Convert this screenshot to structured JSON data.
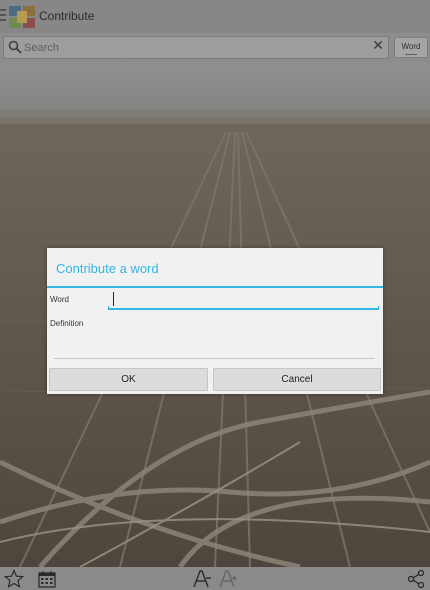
{
  "actionbar": {
    "title": "Contribute"
  },
  "search": {
    "placeholder": "Search",
    "mode_button": "Word"
  },
  "dialog": {
    "title": "Contribute a word",
    "word_label": "Word",
    "word_value": "",
    "definition_label": "Definition",
    "definition_value": "",
    "ok_label": "OK",
    "cancel_label": "Cancel"
  },
  "bottombar": {
    "icons": [
      "star-icon",
      "calendar-icon",
      "font-decrease-icon",
      "font-increase-icon",
      "share-icon"
    ]
  },
  "colors": {
    "accent": "#33b5e5"
  }
}
